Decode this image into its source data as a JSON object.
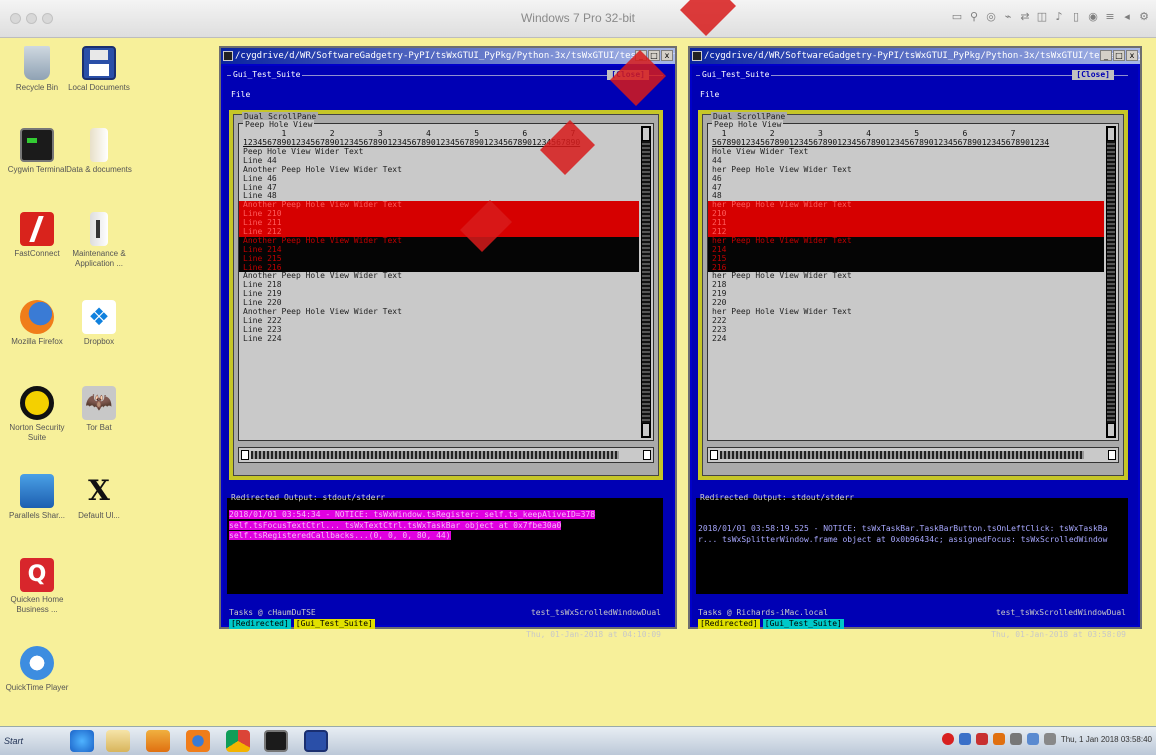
{
  "host": {
    "window_title": "Windows 7 Pro 32-bit"
  },
  "desktop_icons": [
    {
      "label": "Recycle Bin",
      "icon": "recycle-bin-icon"
    },
    {
      "label": "Local Documents",
      "icon": "floppy-disk-icon"
    },
    {
      "label": "Cygwin Terminal",
      "icon": "terminal-icon"
    },
    {
      "label": "Data & documents",
      "icon": "folder-icon"
    },
    {
      "label": "FastConnect",
      "icon": "fastconnect-icon"
    },
    {
      "label": "Maintenance & Application ...",
      "icon": "maintenance-icon"
    },
    {
      "label": "Mozilla Firefox",
      "icon": "firefox-icon"
    },
    {
      "label": "Dropbox",
      "icon": "dropbox-icon"
    },
    {
      "label": "Norton Security Suite",
      "icon": "norton-icon"
    },
    {
      "label": "Tor Bat",
      "icon": "bat-icon"
    },
    {
      "label": "Parallels Shar...",
      "icon": "parallels-icon"
    },
    {
      "label": "Default Ul...",
      "icon": "x-app-icon"
    },
    {
      "label": "Quicken Home Business ...",
      "icon": "quicken-icon"
    },
    {
      "label": "QuickTime Player",
      "icon": "quicktime-icon"
    }
  ],
  "windows": [
    {
      "title": "/cygdrive/d/WR/SoftwareGadgetry-PyPI/tsWxGTUI_PyPkg/Python-3x/tsWxGTUI/tests - python3",
      "suite": "Gui_Test_Suite",
      "clear_button": "[Close]",
      "file_menu": "File",
      "group_label": "Dual ScrollPane",
      "view_label": "Peep Hole View",
      "ruler_numbers": "        1         2         3         4         5         6         7",
      "ruler_digits": "1234567890123456789012345678901234567890123456789012345678901234567890",
      "lines": [
        {
          "text": "Peep Hole View Wider Text",
          "style": "normal"
        },
        {
          "text": "Line 44",
          "style": "normal"
        },
        {
          "text": "Another Peep Hole View Wider Text",
          "style": "normal"
        },
        {
          "text": "Line 46",
          "style": "normal"
        },
        {
          "text": "Line 47",
          "style": "normal"
        },
        {
          "text": "Line 48",
          "style": "normal"
        },
        {
          "text": "Another Peep Hole View Wider Text",
          "style": "red"
        },
        {
          "text": "Line 210",
          "style": "red"
        },
        {
          "text": "Line 211",
          "style": "red"
        },
        {
          "text": "Line 212",
          "style": "red"
        },
        {
          "text": "Another Peep Hole View Wider Text",
          "style": "black"
        },
        {
          "text": "Line 214",
          "style": "black"
        },
        {
          "text": "Line 215",
          "style": "black"
        },
        {
          "text": "Line 216",
          "style": "black"
        },
        {
          "text": "Another Peep Hole View Wider Text",
          "style": "normal"
        },
        {
          "text": "Line 218",
          "style": "normal"
        },
        {
          "text": "Line 219",
          "style": "normal"
        },
        {
          "text": "Line 220",
          "style": "normal"
        },
        {
          "text": "Another Peep Hole View Wider Text",
          "style": "normal"
        },
        {
          "text": "Line 222",
          "style": "normal"
        },
        {
          "text": "Line 223",
          "style": "normal"
        },
        {
          "text": "Line 224",
          "style": "normal"
        }
      ],
      "output_label": "Redirected Output: stdout/stderr",
      "output_text": "2018/01/01 03:54:34 - NOTICE: tsWxWindow.tsRegister: self.ts_keepAliveID=378\nself.tsFocusTextCtrl... tsWxTextCtrl.tsWxTaskBar object at 0x7fbe30a0\nself.tsRegisteredCallbacks...(0, 0, 0, 80, 44)",
      "output_style": "magenta",
      "status_host": "Tasks @ cHaumDuTSE",
      "status_app": "test_tsWxScrolledWindowDual",
      "tag1": "[Redirected]",
      "tag2": "[Gui_Test_Suite]",
      "status_time": "Thu, 01-Jan-2018 at 04:10:09"
    },
    {
      "title": "/cygdrive/d/WR/SoftwareGadgetry-PyPI/tsWxGTUI_PyPkg/Python-3x/tsWxGTUI/tests - python3",
      "suite": "Gui_Test_Suite",
      "clear_button": "[Close]",
      "file_menu": "File",
      "group_label": "Dual ScrollPane",
      "view_label": "Peep Hole View",
      "ruler_numbers": "  1         2         3         4         5         6         7",
      "ruler_digits": "5678901234567890123456789012345678901234567890123456789012345678901234",
      "lines": [
        {
          "text": "Hole View Wider Text",
          "style": "normal"
        },
        {
          "text": "44",
          "style": "normal"
        },
        {
          "text": "her Peep Hole View Wider Text",
          "style": "normal"
        },
        {
          "text": "46",
          "style": "normal"
        },
        {
          "text": "47",
          "style": "normal"
        },
        {
          "text": "48",
          "style": "normal"
        },
        {
          "text": "her Peep Hole View Wider Text",
          "style": "red"
        },
        {
          "text": "210",
          "style": "red"
        },
        {
          "text": "211",
          "style": "red"
        },
        {
          "text": "212",
          "style": "red"
        },
        {
          "text": "her Peep Hole View Wider Text",
          "style": "black"
        },
        {
          "text": "214",
          "style": "black"
        },
        {
          "text": "215",
          "style": "black"
        },
        {
          "text": "216",
          "style": "black"
        },
        {
          "text": "her Peep Hole View Wider Text",
          "style": "normal"
        },
        {
          "text": "218",
          "style": "normal"
        },
        {
          "text": "219",
          "style": "normal"
        },
        {
          "text": "220",
          "style": "normal"
        },
        {
          "text": "her Peep Hole View Wider Text",
          "style": "normal"
        },
        {
          "text": "222",
          "style": "normal"
        },
        {
          "text": "223",
          "style": "normal"
        },
        {
          "text": "224",
          "style": "normal"
        }
      ],
      "output_label": "Redirected Output: stdout/stderr",
      "output_text": "2018/01/01 03:58:19.525 - NOTICE: tsWxTaskBar.TaskBarButton.tsOnLeftClick: tsWxTaskBar... tsWxSplitterWindow.frame object at 0x0b96434c; assignedFocus: tsWxScrolledWindow",
      "output_style": "blue",
      "status_host": "Tasks @ Richards-iMac.local",
      "status_app": "test_tsWxScrolledWindowDual",
      "tag1": "[Redirected]",
      "tag2": "[Gui_Test_Suite]",
      "status_time": "Thu, 01-Jan-2018 at 03:58:09"
    }
  ],
  "taskbar": {
    "start_label": "Start",
    "clock": "Thu, 1 Jan 2018 03:58:40"
  },
  "colors": {
    "desktop": "#f7f09a",
    "terminal_blue": "#0000c8",
    "highlight_red": "#d60000",
    "highlight_black": "#050505",
    "frame_yellow": "#c6c628"
  }
}
